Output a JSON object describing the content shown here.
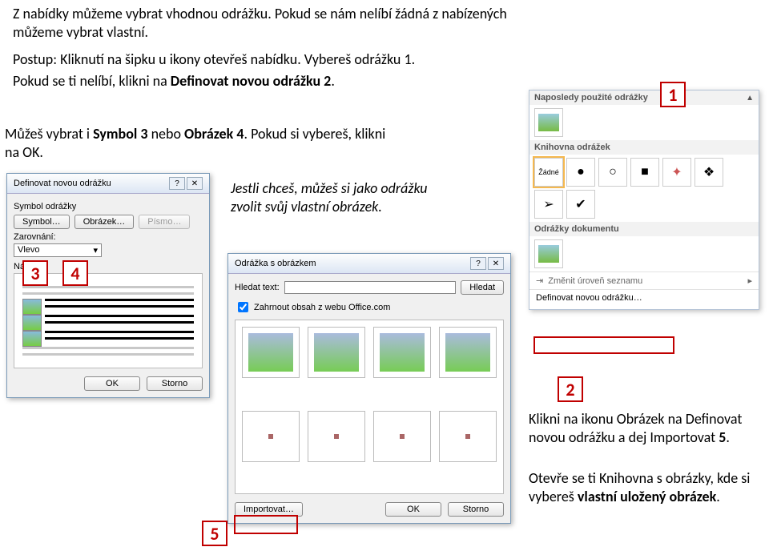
{
  "intro": {
    "line1a": "Z nabídky můžeme vybrat vhodnou odrážku. Pokud se nám nelíbí žádná z nabízených",
    "line1b": "můžeme vybrat vlastní.",
    "step_a": "Postup: Kliknutí na šipku u ikony otevřeš nabídku. Vybereš odrážku ",
    "step_a_num": "1",
    "step_a_end": ".",
    "step_b_pre": "Pokud se ti nelíbí, klikni na ",
    "step_b_bold": "Definovat novou odrážku 2",
    "step_b_end": ".",
    "step_c_pre": "Můžeš vybrat i ",
    "step_c_bold1": "Symbol 3",
    "step_c_mid": " nebo ",
    "step_c_bold2": "Obrázek 4",
    "step_c_end": ". Pokud si vybereš, klikni na OK.",
    "italic": "Jestli chceš, můžeš si jako odrážku zvolit svůj vlastní obrázek.",
    "right1": "Klikni na ikonu Obrázek na Definovat novou odrážku a dej Importovat ",
    "right1_bold": "5",
    "right1_end": ".",
    "right2_pre": "Otevře se ti Knihovna s obrázky, kde si vybereš ",
    "right2_bold": "vlastní uložený obrázek",
    "right2_end": "."
  },
  "callouts": {
    "1": "1",
    "2": "2",
    "3": "3",
    "4": "4",
    "5": "5"
  },
  "dlg_define": {
    "title": "Definovat novou odrážku",
    "grp_symbol": "Symbol odrážky",
    "btn_symbol": "Symbol…",
    "btn_picture": "Obrázek…",
    "btn_font": "Písmo…",
    "lbl_align": "Zarovnání:",
    "align_val": "Vlevo",
    "lbl_preview": "Náhled",
    "ok": "OK",
    "cancel": "Storno"
  },
  "dlg_pic": {
    "title": "Odrážka s obrázkem",
    "lbl_search": "Hledat text:",
    "btn_search": "Hledat",
    "chk_office": "Zahrnout obsah z webu Office.com",
    "btn_import": "Importovat…",
    "ok": "OK",
    "cancel": "Storno"
  },
  "panel": {
    "hd_recent": "Naposledy použité odrážky",
    "hd_library": "Knihovna odrážek",
    "hd_doc": "Odrážky dokumentu",
    "none": "Žádné",
    "item_level": "Změnit úroveň seznamu",
    "item_define": "Definovat novou odrážku…"
  }
}
